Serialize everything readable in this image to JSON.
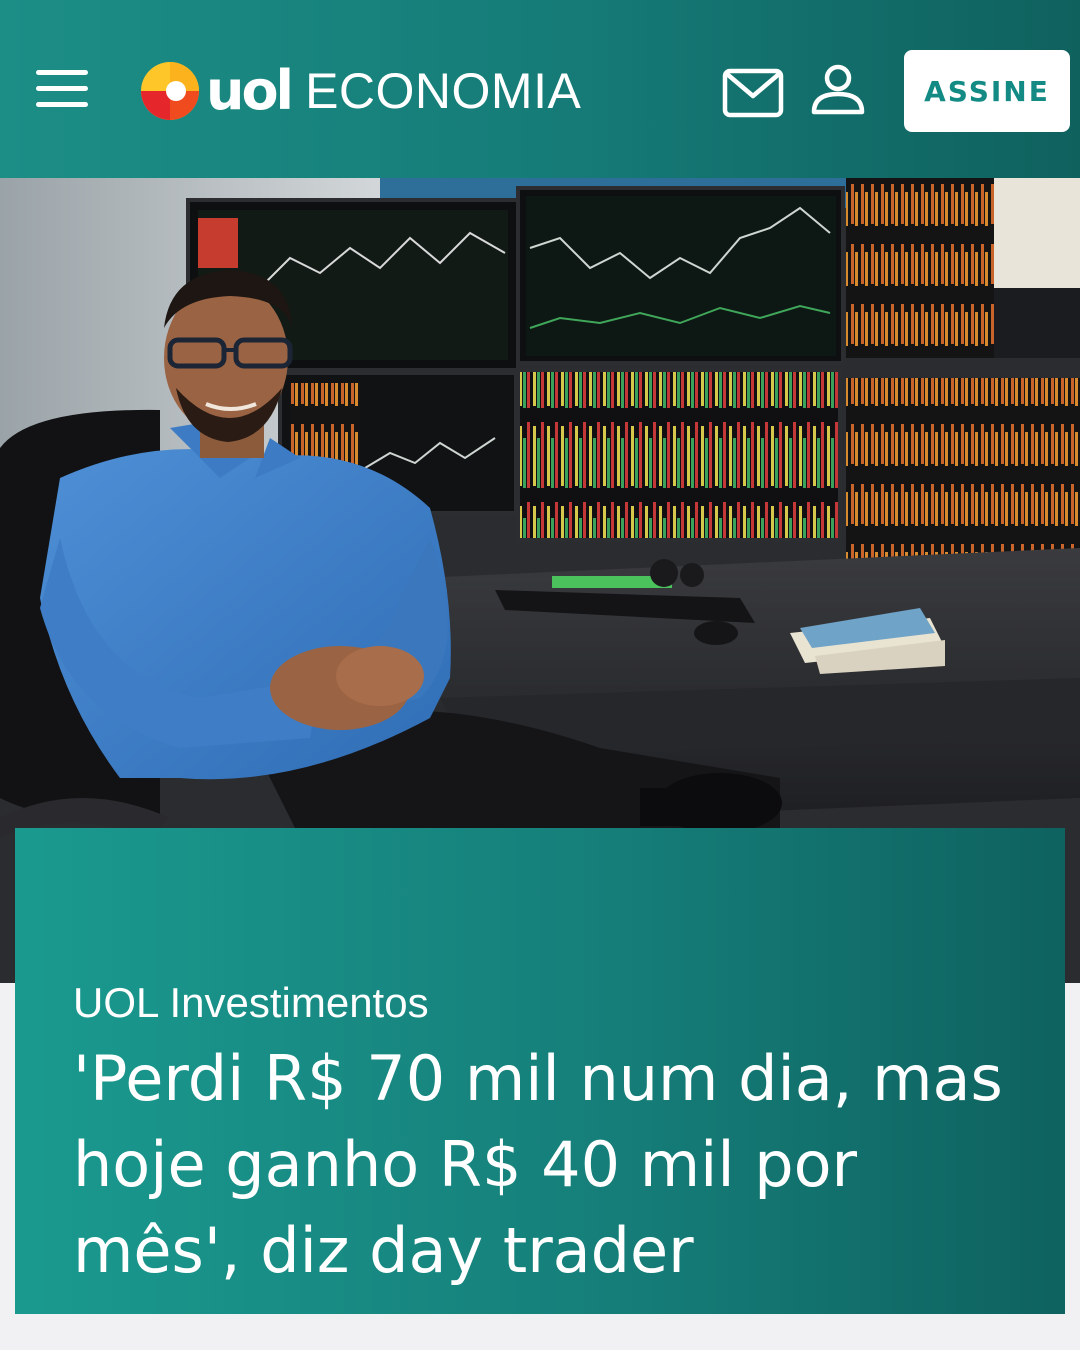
{
  "header": {
    "logo_text": "uol",
    "section": "ECONOMIA",
    "subscribe_label": "ASSINE"
  },
  "hero": {
    "image": "man-in-blue-shirt-seated-before-trading-monitors"
  },
  "article": {
    "kicker": "UOL Investimentos",
    "headline": "'Perdi R$ 70 mil num dia, mas hoje ganho R$ 40 mil por mês', diz day trader"
  },
  "icons": {
    "menu": "hamburger-menu-icon",
    "mail": "envelope-icon",
    "user": "user-icon",
    "logo": "uol-ball-icon"
  },
  "colors": {
    "brand_teal": "#167c78",
    "card_teal": "#1a9a8f",
    "subscribe_text": "#138a84",
    "logo_yellow": "#ffc629",
    "logo_red": "#e5262b"
  }
}
